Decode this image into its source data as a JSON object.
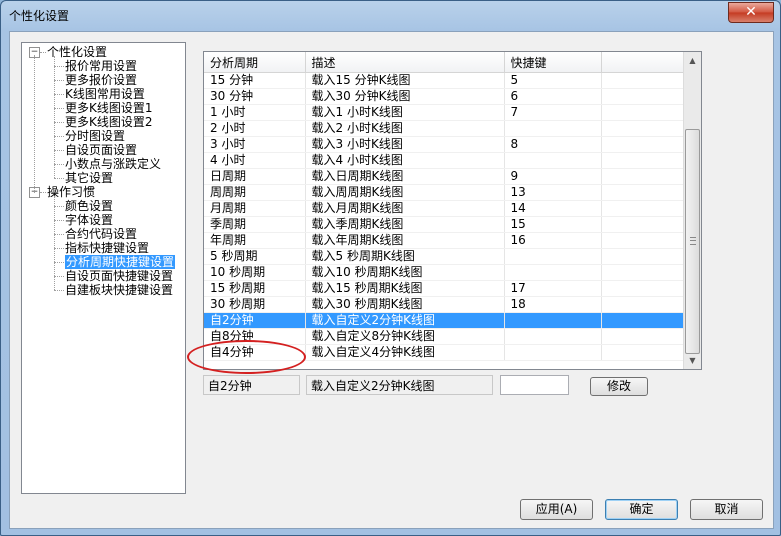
{
  "window": {
    "title": "个性化设置",
    "close_label": "✕"
  },
  "tree": {
    "groups": [
      {
        "label": "个性化设置",
        "expanded": true,
        "items": [
          "报价常用设置",
          "更多报价设置",
          "K线图常用设置",
          "更多K线图设置1",
          "更多K线图设置2",
          "分时图设置",
          "自设页面设置",
          "小数点与涨跌定义",
          "其它设置"
        ]
      },
      {
        "label": "操作习惯",
        "expanded": true,
        "items": [
          "颜色设置",
          "字体设置",
          "合约代码设置",
          "指标快捷键设置",
          "分析周期快捷键设置",
          "自设页面快捷键设置",
          "自建板块快捷键设置"
        ]
      }
    ],
    "selected": "分析周期快捷键设置",
    "collapse_glyph": "−"
  },
  "grid": {
    "headers": [
      "分析周期",
      "描述",
      "快捷键"
    ],
    "rows": [
      [
        "15 分钟",
        "载入15 分钟K线图",
        "5"
      ],
      [
        "30 分钟",
        "载入30 分钟K线图",
        "6"
      ],
      [
        "1 小时",
        "载入1 小时K线图",
        "7"
      ],
      [
        "2 小时",
        "载入2 小时K线图",
        ""
      ],
      [
        "3 小时",
        "载入3 小时K线图",
        "8"
      ],
      [
        "4 小时",
        "载入4 小时K线图",
        ""
      ],
      [
        "日周期",
        "载入日周期K线图",
        "9"
      ],
      [
        "周周期",
        "载入周周期K线图",
        "13"
      ],
      [
        "月周期",
        "载入月周期K线图",
        "14"
      ],
      [
        "季周期",
        "载入季周期K线图",
        "15"
      ],
      [
        "年周期",
        "载入年周期K线图",
        "16"
      ],
      [
        "5 秒周期",
        "载入5 秒周期K线图",
        ""
      ],
      [
        "10 秒周期",
        "载入10 秒周期K线图",
        ""
      ],
      [
        "15 秒周期",
        "载入15 秒周期K线图",
        "17"
      ],
      [
        "30 秒周期",
        "载入30 秒周期K线图",
        "18"
      ],
      [
        "自2分钟",
        "载入自定义2分钟K线图",
        ""
      ],
      [
        "自8分钟",
        "载入自定义8分钟K线图",
        ""
      ],
      [
        "自4分钟",
        "载入自定义4分钟K线图",
        ""
      ]
    ],
    "selected_index": 15
  },
  "editor": {
    "period": "自2分钟",
    "description": "载入自定义2分钟K线图",
    "shortcut": "",
    "modify_label": "修改"
  },
  "buttons": {
    "apply": "应用(A)",
    "ok": "确定",
    "cancel": "取消"
  },
  "scrollbar": {
    "up_glyph": "▲",
    "down_glyph": "▼"
  },
  "colors": {
    "selection": "#3399ff",
    "annotation": "#d42020"
  }
}
